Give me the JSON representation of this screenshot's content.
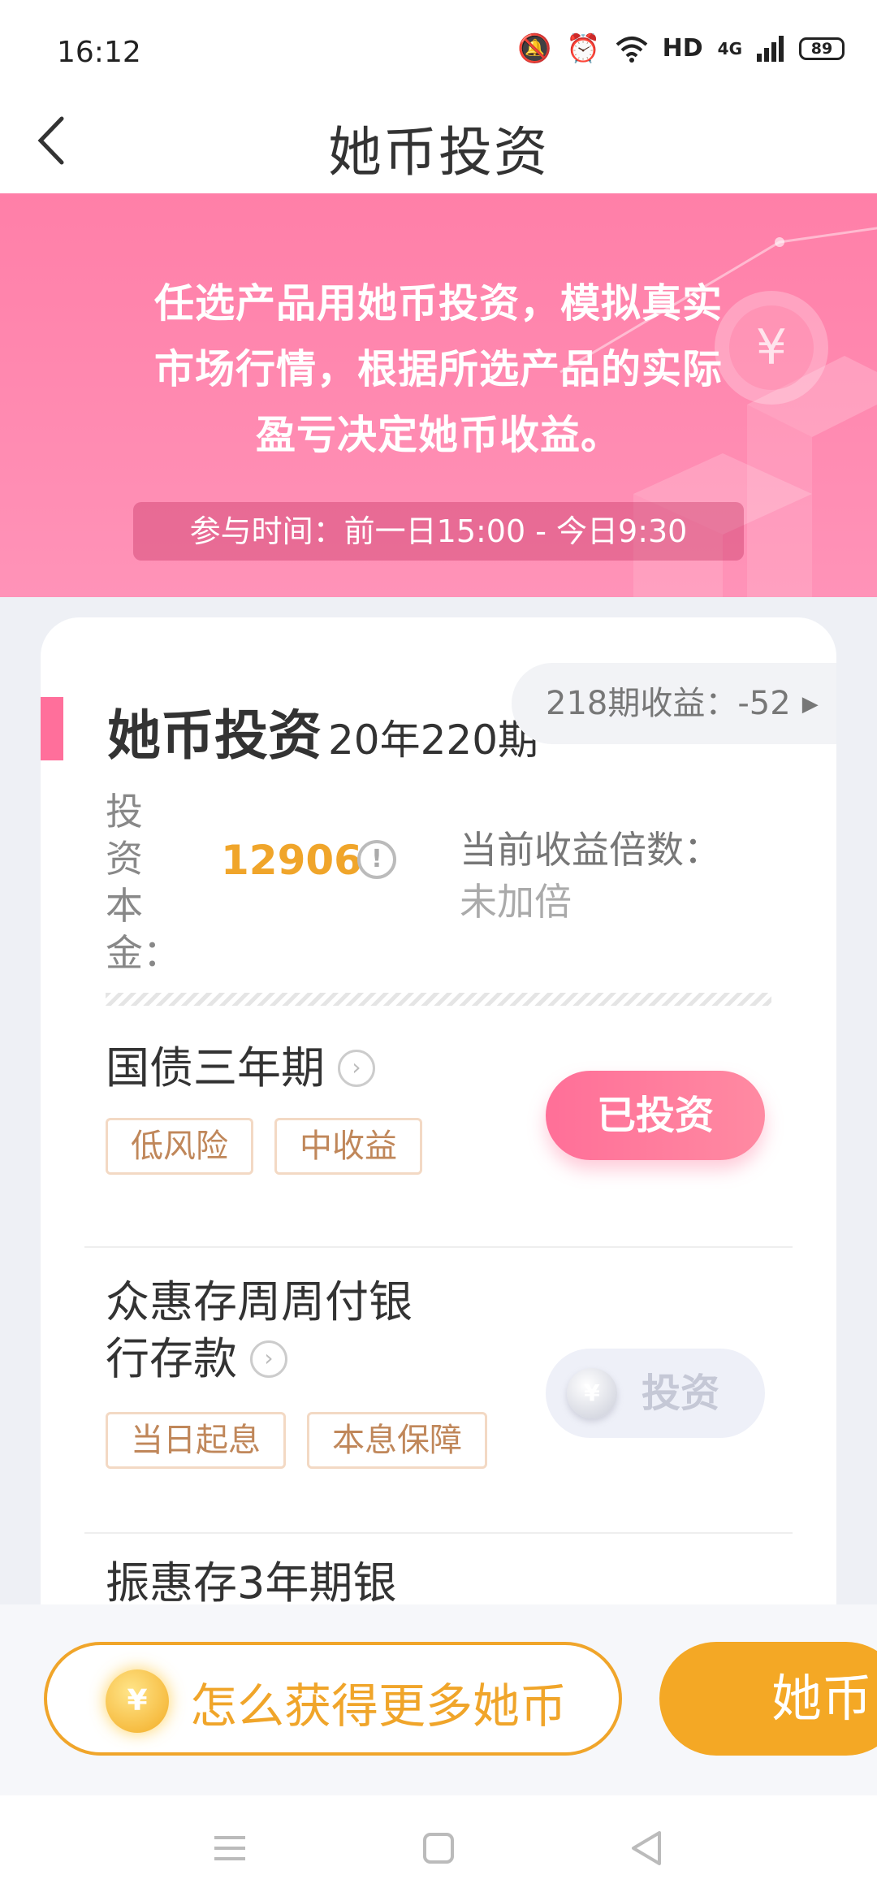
{
  "status_bar": {
    "time": "16:12",
    "hd_label": "HD",
    "network_label": "4G",
    "battery": "89",
    "icons": [
      "mute-icon",
      "alarm-icon",
      "wifi-icon",
      "signal-icon",
      "battery-icon"
    ]
  },
  "nav": {
    "title": "她币投资",
    "back_icon": "chevron-left-icon"
  },
  "banner": {
    "lines": [
      "任选产品用她币投资，模拟真实",
      "市场行情，根据所选产品的实际",
      "盈亏决定她币收益。"
    ],
    "participation_time": "参与时间：前一日15:00 - 今日9:30"
  },
  "card": {
    "title": "她币投资",
    "period": "20年220期",
    "prev_profit": "218期收益：-52",
    "principal_label": "投资本金：",
    "principal_value": "12906",
    "multiplier_label": "当前收益倍数：",
    "multiplier_value": "未加倍"
  },
  "products": [
    {
      "name": "国债三年期",
      "tags": [
        "低风险",
        "中收益"
      ],
      "action": "已投资",
      "state": "invested"
    },
    {
      "name_lines": [
        "众惠存周周付银",
        "行存款"
      ],
      "tags": [
        "当日起息",
        "本息保障"
      ],
      "action": "投资",
      "state": "available"
    },
    {
      "name": "振惠存3年期银"
    }
  ],
  "bottom_bar": {
    "more_coins_label": "怎么获得更多她币",
    "coin_symbol": "¥",
    "coins_button_label": "她币"
  },
  "colors": {
    "accent_pink": "#ff6f9b",
    "banner_pink": "#ff8fb5",
    "gold": "#f0a52a",
    "tag_border": "#f3d9c4",
    "tag_text": "#c0875a"
  }
}
